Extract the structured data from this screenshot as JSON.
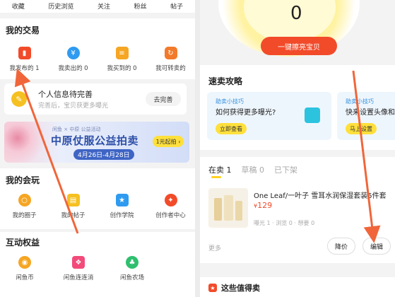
{
  "left": {
    "topnav": [
      "收藏",
      "历史浏览",
      "关注",
      "粉丝",
      "帖子"
    ],
    "trade_title": "我的交易",
    "trade_items": [
      {
        "label": "我发布的 1",
        "icon": "shopping-bag-icon",
        "color": "#f24b2a"
      },
      {
        "label": "我卖出的 0",
        "icon": "yen-icon",
        "color": "#2f9bf0"
      },
      {
        "label": "我买到的 0",
        "icon": "receipt-icon",
        "color": "#f5a623"
      },
      {
        "label": "我可转卖的",
        "icon": "resell-icon",
        "color": "#f27a2a"
      }
    ],
    "info": {
      "title": "个人信息待完善",
      "subtitle": "完善后，宝贝获更多曝光",
      "button": "去完善"
    },
    "banner": {
      "sub": "闲鱼 × 中原 公益活动",
      "title": "中原仗服公益拍卖",
      "date": "4月26日-4月28日",
      "button": "1元起拍 ›"
    },
    "play_title": "我的会玩",
    "play_items": [
      {
        "label": "我的圈子",
        "icon": "circle-icon",
        "color": "#f5a623"
      },
      {
        "label": "我的帖子",
        "icon": "post-icon",
        "color": "#f5c022"
      },
      {
        "label": "创作学院",
        "icon": "star-icon",
        "color": "#2f9bf0"
      },
      {
        "label": "创作者中心",
        "icon": "bulb-icon",
        "color": "#f24b2a"
      }
    ],
    "rights_title": "互动权益",
    "rights_items": [
      {
        "label": "闲鱼币",
        "icon": "coin-icon",
        "color": "#f5a623"
      },
      {
        "label": "闲鱼连连消",
        "icon": "game-icon",
        "color": "#f24b7a"
      },
      {
        "label": "闲鱼农场",
        "icon": "farm-icon",
        "color": "#2fbf6f"
      }
    ]
  },
  "right": {
    "exposure_value": "0",
    "polish_button": "一键擦亮宝贝",
    "sell_title": "速卖攻略",
    "tips": [
      {
        "head": "助卖小技巧",
        "question": "如何获得更多曝光?",
        "button": "立即查看"
      },
      {
        "head": "助卖小技巧",
        "question": "快来设置头像和",
        "button": "马上设置"
      }
    ],
    "tabs": [
      {
        "label": "在卖 1",
        "active": true
      },
      {
        "label": "草稿 0",
        "active": false
      },
      {
        "label": "已下架",
        "active": false
      }
    ],
    "item": {
      "title": "One Leaf/一叶子 雪耳水润保湿套装5件套",
      "currency": "¥",
      "price": "129",
      "stats": "曝光 1 · 浏览 0 · 想要 0"
    },
    "more": "更多",
    "reduce_button": "降价",
    "edit_button": "编辑",
    "worth_title": "这些值得卖"
  },
  "colors": {
    "accent": "#f24b2a",
    "yellow": "#ffe03c",
    "arrow": "#f0663a"
  }
}
